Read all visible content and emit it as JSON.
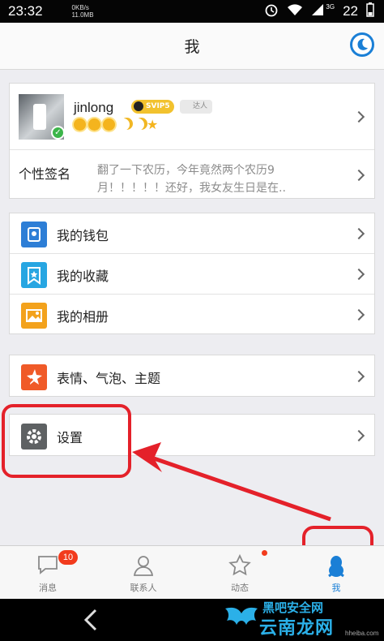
{
  "status_bar": {
    "time": "23:32",
    "net_speed_top": "0KB/s",
    "net_speed_bottom": "11.0MB",
    "signal_label": "3G",
    "battery": "22"
  },
  "header": {
    "title": "我"
  },
  "profile": {
    "nickname": "jinlong",
    "svip_label": "SVIP5",
    "talent_label": "达人",
    "level_icons": [
      "sun",
      "sun",
      "sun",
      "moon",
      "moon",
      "star"
    ],
    "signature_label": "个性签名",
    "signature_text": "翻了一下农历，今年竟然两个农历9月！！！！！还好，我女友生日是在.."
  },
  "menu_group_1": [
    {
      "label": "我的钱包",
      "icon": "wallet-icon",
      "color": "#2d7ed6"
    },
    {
      "label": "我的收藏",
      "icon": "favorites-icon",
      "color": "#27a6e2"
    },
    {
      "label": "我的相册",
      "icon": "album-icon",
      "color": "#f3a21c"
    }
  ],
  "menu_group_2": [
    {
      "label": "表情、气泡、主题",
      "icon": "emoji-theme-icon",
      "color": "#f05a28"
    }
  ],
  "menu_group_3": [
    {
      "label": "设置",
      "icon": "gear-icon",
      "color": "#5e6163"
    }
  ],
  "tabs": [
    {
      "label": "消息",
      "icon": "message-icon",
      "badge": "10"
    },
    {
      "label": "联系人",
      "icon": "contacts-icon"
    },
    {
      "label": "动态",
      "icon": "star-icon"
    },
    {
      "label": "我",
      "icon": "penguin-icon",
      "active": true
    }
  ],
  "watermark": {
    "top_text": "黑吧安全网",
    "main_text": "云南龙网",
    "sub_text": "hheiba.com"
  },
  "colors": {
    "accent": "#1a7fd6",
    "annotation": "#e4212a",
    "badge": "#f23b1d"
  }
}
